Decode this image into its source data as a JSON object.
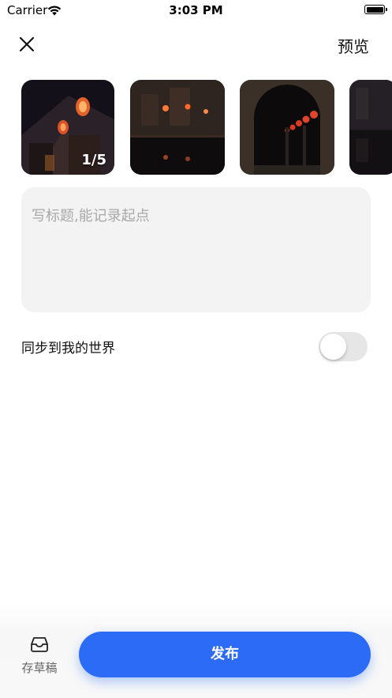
{
  "status_bar": {
    "carrier": "Carrier",
    "time": "3:03 PM",
    "wifi_icon": "wifi-icon",
    "battery_icon": "battery-icon"
  },
  "nav": {
    "close_icon": "close-icon",
    "preview_label": "预览"
  },
  "images": {
    "count_label": "1/5",
    "thumbnails": [
      "lantern-street-night",
      "lanterns-reflected-canal",
      "arched-corridor-lanterns",
      "night-street-partial"
    ]
  },
  "title_input": {
    "value": "",
    "placeholder": "写标题,能记录起点"
  },
  "sync": {
    "label": "同步到我的世界",
    "enabled": false
  },
  "bottom": {
    "drafts_icon": "inbox-tray-icon",
    "drafts_label": "存草稿",
    "publish_label": "发布"
  },
  "colors": {
    "accent": "#2b6bf6",
    "input_bg": "#f3f3f3",
    "toggle_off": "#e6e6e6"
  }
}
